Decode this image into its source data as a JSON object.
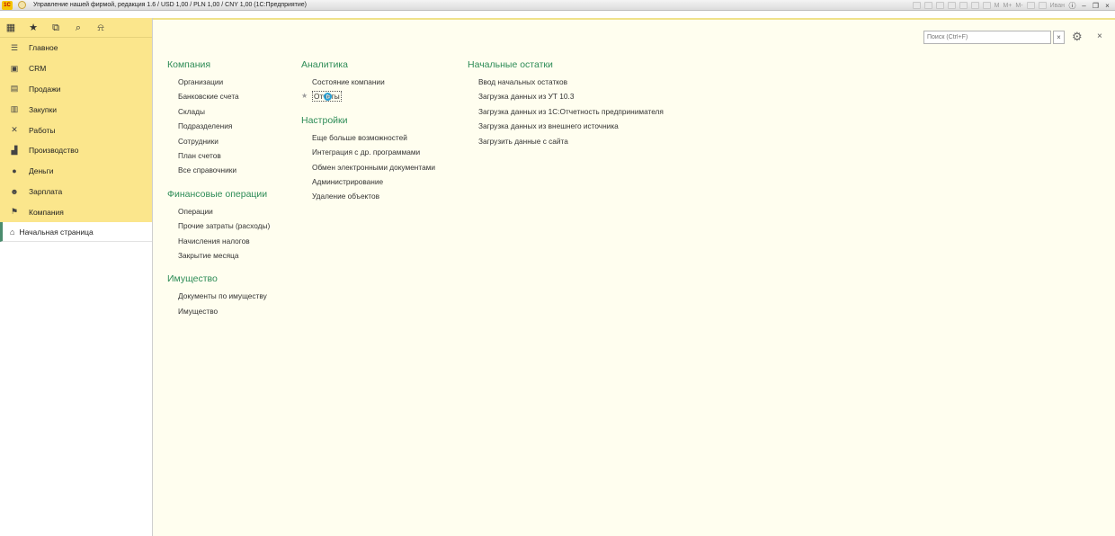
{
  "titlebar": {
    "logo": "1С",
    "title": "Управление нашей фирмой, редакция 1.6 / USD 1,00 / PLN 1,00 / CNY 1,00  (1С:Предприятие)",
    "memory_labels": [
      "M",
      "M+",
      "M-"
    ],
    "user": "Иван"
  },
  "sidebar": {
    "toolbar_icons": [
      "apps-grid-icon",
      "star-icon",
      "history-icon",
      "search-icon",
      "bell-icon"
    ],
    "sections": [
      {
        "label": "Главное",
        "icon": "menu-lines-icon"
      },
      {
        "label": "CRM",
        "icon": "crm-card-icon"
      },
      {
        "label": "Продажи",
        "icon": "sales-icon"
      },
      {
        "label": "Закупки",
        "icon": "purchases-icon"
      },
      {
        "label": "Работы",
        "icon": "tools-icon"
      },
      {
        "label": "Производство",
        "icon": "factory-icon"
      },
      {
        "label": "Деньги",
        "icon": "money-icon"
      },
      {
        "label": "Зарплата",
        "icon": "people-icon"
      },
      {
        "label": "Компания",
        "icon": "flag-icon"
      }
    ],
    "home": {
      "label": "Начальная страница",
      "icon": "home-icon"
    }
  },
  "search": {
    "placeholder": "Поиск (Ctrl+F)",
    "clear": "×"
  },
  "columns": [
    {
      "groups": [
        {
          "title": "Компания",
          "items": [
            "Организации",
            "Банковские счета",
            "Склады",
            "Подразделения",
            "Сотрудники",
            "План счетов",
            "Все справочники"
          ]
        },
        {
          "title": "Финансовые операции",
          "items": [
            "Операции",
            "Прочие затраты (расходы)",
            "Начисления налогов",
            "Закрытие месяца"
          ]
        },
        {
          "title": "Имущество",
          "items": [
            "Документы по имуществу",
            "Имущество"
          ]
        }
      ]
    },
    {
      "groups": [
        {
          "title": "Аналитика",
          "items": [
            "Состояние компании",
            "Отчеты"
          ]
        },
        {
          "title": "Настройки",
          "items": [
            "Еще больше возможностей",
            "Интеграция с др. программами",
            "Обмен электронными документами",
            "Администрирование",
            "Удаление объектов"
          ]
        }
      ]
    },
    {
      "groups": [
        {
          "title": "Начальные остатки",
          "items": [
            "Ввод начальных остатков",
            "Загрузка данных из УТ 10.3",
            "Загрузка данных из 1С:Отчетность предпринимателя",
            "Загрузка данных из внешнего источника",
            "Загрузить данные с сайта"
          ]
        }
      ]
    }
  ],
  "colors": {
    "accent_green": "#2d8c57",
    "sidebar_yellow": "#fbe68c",
    "main_bg": "#fffeef"
  }
}
